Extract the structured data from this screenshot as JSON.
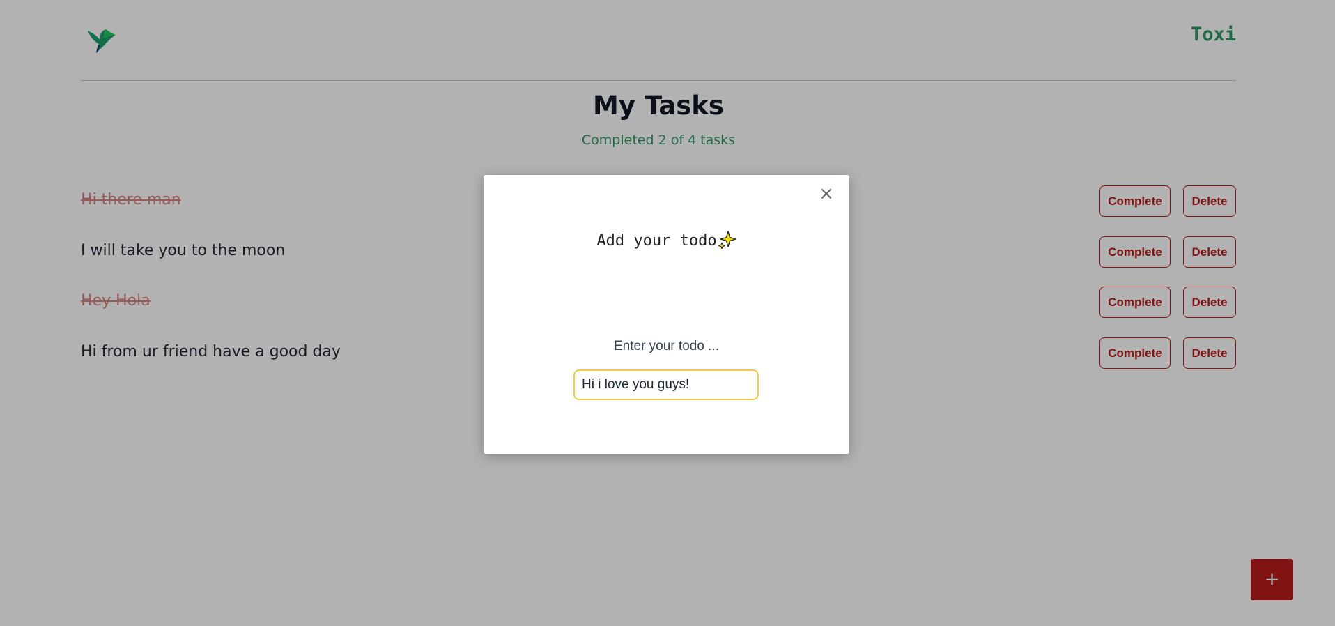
{
  "header": {
    "logo_icon": "hummingbird-logo-icon",
    "brand": "Toxi"
  },
  "main": {
    "title": "My Tasks",
    "subtitle": "Completed 2 of 4 tasks",
    "tasks": [
      {
        "text": "Hi there man",
        "completed": true
      },
      {
        "text": "I will take you to the moon",
        "completed": false
      },
      {
        "text": "Hey Hola",
        "completed": true
      },
      {
        "text": "Hi from ur friend have a good day",
        "completed": false
      }
    ],
    "complete_label": "Complete",
    "delete_label": "Delete",
    "add_button_label": "+"
  },
  "modal": {
    "close_label": "×",
    "heading": "Add your todo",
    "heading_icon": "sparkle-icon",
    "field_label": "Enter your todo ...",
    "input_value": "Hi i love you guys!"
  },
  "colors": {
    "brand_green": "#2f9a64",
    "danger_red": "#b91c1c",
    "input_focus": "#f2c94c"
  }
}
